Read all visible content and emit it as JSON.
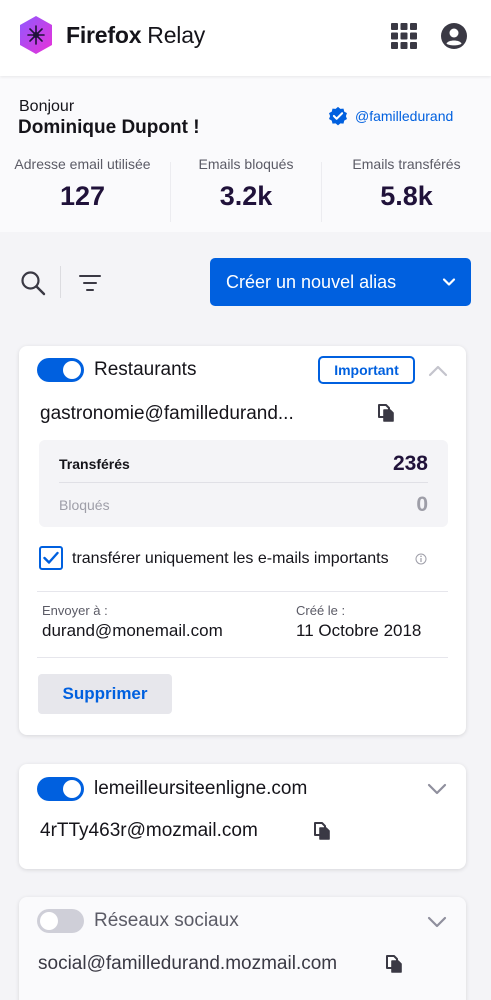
{
  "header": {
    "brand_strong": "Firefox",
    "brand_light": "Relay",
    "logo_icon": "relay-logo-icon",
    "apps_icon": "apps-grid-icon",
    "account_icon": "account-icon"
  },
  "greeting": {
    "hello": "Bonjour",
    "name": "Dominique Dupont  !",
    "handle": "@familledurand",
    "handle_icon": "verified-badge-icon"
  },
  "stats": [
    {
      "label": "Adresse email utilisée",
      "value": "127"
    },
    {
      "label": "Emails bloqués",
      "value": "3.2k"
    },
    {
      "label": "Emails transférés",
      "value": "5.8k"
    }
  ],
  "toolbar": {
    "search_icon": "search-icon",
    "filter_icon": "filter-icon",
    "create_label": "Créer un nouvel alias"
  },
  "aliases": [
    {
      "label": "Restaurants",
      "enabled": true,
      "expanded": true,
      "badge": "Important",
      "address": "gastronomie@familledurand...",
      "forwarded_label": "Transférés",
      "forwarded_value": "238",
      "blocked_label": "Bloqués",
      "blocked_value": "0",
      "checkbox_label": "transférer uniquement les e-mails importants",
      "checkbox_checked": true,
      "send_to_label": "Envoyer à :",
      "send_to_value": "durand@monemail.com",
      "created_label": "Créé le :",
      "created_value": "11 Octobre 2018",
      "delete_label": "Supprimer"
    },
    {
      "label": "lemeilleursiteenligne.com",
      "enabled": true,
      "expanded": false,
      "address": "4rTTy463r@mozmail.com"
    },
    {
      "label": "Réseaux sociaux",
      "enabled": false,
      "expanded": false,
      "address": "social@familledurand.mozmail.com"
    }
  ],
  "colors": {
    "accent": "#0060df",
    "background": "#f4f4f7",
    "text": "#15141a",
    "logo_gradient_start": "#9059ff",
    "logo_gradient_end": "#e931d8"
  }
}
